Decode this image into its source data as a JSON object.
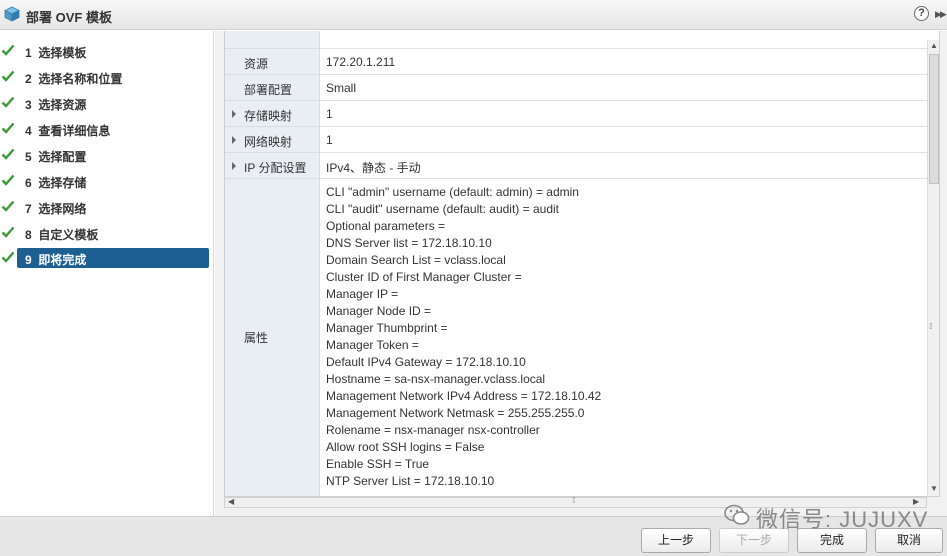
{
  "window": {
    "title": "部署 OVF 模板"
  },
  "steps": [
    {
      "num": "1",
      "label": "选择模板",
      "completed": true
    },
    {
      "num": "2",
      "label": "选择名称和位置",
      "completed": true
    },
    {
      "num": "3",
      "label": "选择资源",
      "completed": true
    },
    {
      "num": "4",
      "label": "查看详细信息",
      "completed": true
    },
    {
      "num": "5",
      "label": "选择配置",
      "completed": true
    },
    {
      "num": "6",
      "label": "选择存储",
      "completed": true
    },
    {
      "num": "7",
      "label": "选择网络",
      "completed": true
    },
    {
      "num": "8",
      "label": "自定义模板",
      "completed": true
    },
    {
      "num": "9",
      "label": "即将完成",
      "completed": true,
      "active": true
    }
  ],
  "summary": {
    "resource": {
      "label": "资源",
      "value": "172.20.1.211"
    },
    "config": {
      "label": "部署配置",
      "value": "Small"
    },
    "storage": {
      "label": "存储映射",
      "value": "1"
    },
    "network": {
      "label": "网络映射",
      "value": "1"
    },
    "ip": {
      "label": "IP 分配设置",
      "value": "IPv4、静态 - 手动"
    },
    "properties": {
      "label": "属性",
      "lines": [
        "CLI \"admin\" username (default: admin) = admin",
        "CLI \"audit\" username (default: audit) = audit",
        "Optional parameters =",
        "DNS Server list = 172.18.10.10",
        "Domain Search List = vclass.local",
        "Cluster ID of First Manager Cluster =",
        "Manager IP =",
        "Manager Node ID =",
        "Manager Thumbprint =",
        "Manager Token =",
        "Default IPv4 Gateway = 172.18.10.10",
        "Hostname = sa-nsx-manager.vclass.local",
        "Management Network IPv4 Address = 172.18.10.42",
        "Management Network Netmask = 255.255.255.0",
        "Rolename = nsx-manager nsx-controller",
        "Allow root SSH logins = False",
        "Enable SSH = True",
        "NTP Server List = 172.18.10.10"
      ]
    }
  },
  "footer": {
    "back": "上一步",
    "next": "下一步",
    "finish": "完成",
    "cancel": "取消"
  },
  "watermark": {
    "text": "微信号: JUJUXV"
  },
  "icons": {
    "window": "ovf-template-icon",
    "help": "help-icon",
    "expand": "expand-panel-icon"
  },
  "colors": {
    "active_step": "#1e5f92",
    "check": "#3a9a3a",
    "label_bg": "#e9eef4"
  }
}
